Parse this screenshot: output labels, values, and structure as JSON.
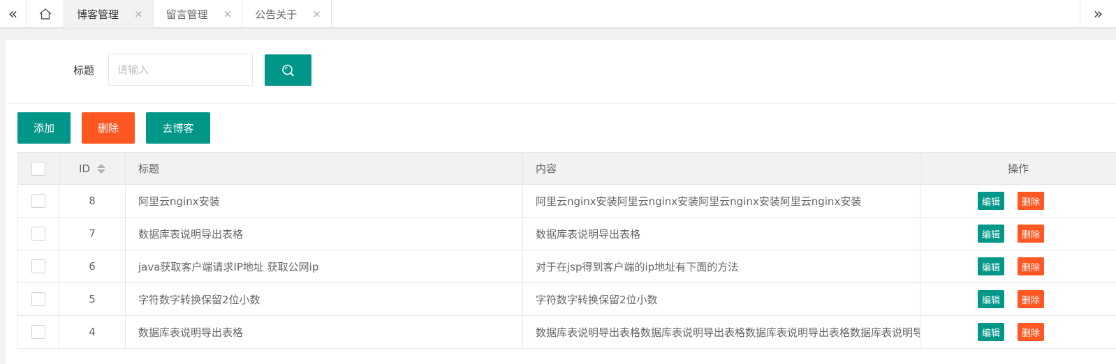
{
  "tabs": {
    "home_icon": "home-icon",
    "items": [
      {
        "label": "博客管理",
        "active": true
      },
      {
        "label": "留言管理",
        "active": false
      },
      {
        "label": "公告关于",
        "active": false
      }
    ],
    "close_glyph": "×"
  },
  "search": {
    "label": "标题",
    "placeholder": "请输入",
    "value": ""
  },
  "toolbar": {
    "add_label": "添加",
    "delete_label": "删除",
    "blog_label": "去博客"
  },
  "table": {
    "columns": {
      "id": "ID",
      "title": "标题",
      "content": "内容",
      "actions": "操作"
    },
    "edit_label": "编辑",
    "delete_label": "删除",
    "rows": [
      {
        "id": "8",
        "title": "阿里云nginx安装",
        "content": "阿里云nginx安装阿里云nginx安装阿里云nginx安装阿里云nginx安装"
      },
      {
        "id": "7",
        "title": "数据库表说明导出表格",
        "content": "数据库表说明导出表格"
      },
      {
        "id": "6",
        "title": "java获取客户端请求IP地址 获取公网ip",
        "content": "对于在jsp得到客户端的ip地址有下面的方法"
      },
      {
        "id": "5",
        "title": "字符数字转换保留2位小数",
        "content": "字符数字转换保留2位小数"
      },
      {
        "id": "4",
        "title": "数据库表说明导出表格",
        "content": "数据库表说明导出表格数据库表说明导出表格数据库表说明导出表格数据库表说明导出表格"
      }
    ]
  },
  "colors": {
    "primary": "#009688",
    "danger": "#ff5722"
  }
}
